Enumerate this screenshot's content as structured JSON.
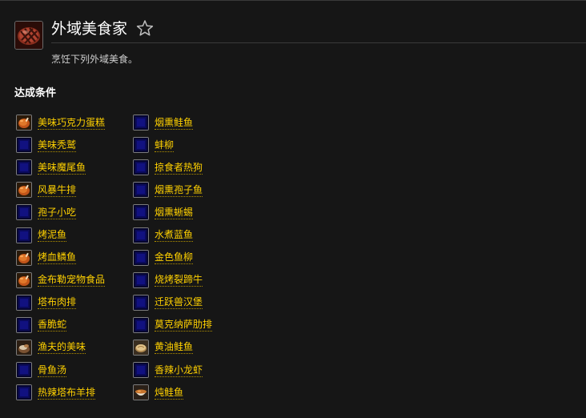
{
  "achievement": {
    "title": "外域美食家",
    "description": "烹饪下列外域美食。",
    "icon": "grilled-steak-icon",
    "favorite_icon": "star-outline-icon"
  },
  "criteria": {
    "heading": "达成条件",
    "left": [
      {
        "label": "美味巧克力蛋糕",
        "icon": "roast-chicken-icon"
      },
      {
        "label": "美味秃鹫",
        "icon": "blue-placeholder-icon"
      },
      {
        "label": "美味魔尾鱼",
        "icon": "blue-placeholder-icon"
      },
      {
        "label": "风暴牛排",
        "icon": "roast-chicken-icon"
      },
      {
        "label": "孢子小吃",
        "icon": "blue-placeholder-icon"
      },
      {
        "label": "烤泥鱼",
        "icon": "blue-placeholder-icon"
      },
      {
        "label": "烤血鳞鱼",
        "icon": "roast-chicken-icon"
      },
      {
        "label": "金布勒宠物食品",
        "icon": "roast-chicken-icon"
      },
      {
        "label": "塔布肉排",
        "icon": "blue-placeholder-icon"
      },
      {
        "label": "香脆蛇",
        "icon": "blue-placeholder-icon"
      },
      {
        "label": "渔夫的美味",
        "icon": "fish-meal-icon"
      },
      {
        "label": "骨鱼汤",
        "icon": "blue-placeholder-icon"
      },
      {
        "label": "热辣塔布羊排",
        "icon": "blue-placeholder-icon"
      }
    ],
    "right": [
      {
        "label": "烟熏鲑鱼",
        "icon": "blue-placeholder-icon"
      },
      {
        "label": "蚌柳",
        "icon": "blue-placeholder-icon"
      },
      {
        "label": "掠食者热狗",
        "icon": "blue-placeholder-icon"
      },
      {
        "label": "烟熏孢子鱼",
        "icon": "blue-placeholder-icon"
      },
      {
        "label": "烟熏蜥蜴",
        "icon": "blue-placeholder-icon"
      },
      {
        "label": "水煮蓝鱼",
        "icon": "blue-placeholder-icon"
      },
      {
        "label": "金色鱼柳",
        "icon": "blue-placeholder-icon"
      },
      {
        "label": "烧烤裂蹄牛",
        "icon": "blue-placeholder-icon"
      },
      {
        "label": "迁跃兽汉堡",
        "icon": "blue-placeholder-icon"
      },
      {
        "label": "莫克纳萨肋排",
        "icon": "blue-placeholder-icon"
      },
      {
        "label": "黄油鲑鱼",
        "icon": "bread-icon"
      },
      {
        "label": "香辣小龙虾",
        "icon": "blue-placeholder-icon"
      },
      {
        "label": "炖鲑鱼",
        "icon": "stew-bowl-icon"
      }
    ]
  }
}
